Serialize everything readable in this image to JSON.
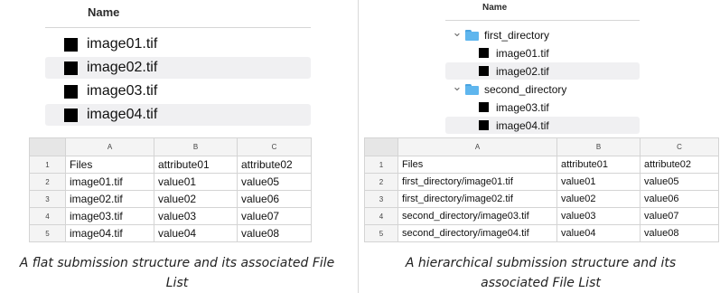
{
  "left": {
    "header": "Name",
    "files": [
      {
        "name": "image01.tif",
        "shaded": false
      },
      {
        "name": "image02.tif",
        "shaded": true
      },
      {
        "name": "image03.tif",
        "shaded": false
      },
      {
        "name": "image04.tif",
        "shaded": true
      }
    ],
    "sheet": {
      "columns": [
        "A",
        "B",
        "C"
      ],
      "rows": [
        {
          "num": "1",
          "cells": [
            "Files",
            "attribute01",
            "attribute02"
          ]
        },
        {
          "num": "2",
          "cells": [
            "image01.tif",
            "value01",
            "value05"
          ]
        },
        {
          "num": "3",
          "cells": [
            "image02.tif",
            "value02",
            "value06"
          ]
        },
        {
          "num": "4",
          "cells": [
            "image03.tif",
            "value03",
            "value07"
          ]
        },
        {
          "num": "5",
          "cells": [
            "image04.tif",
            "value04",
            "value08"
          ]
        }
      ]
    },
    "caption_lines": [
      "A flat submission structure and its associated File",
      "List"
    ]
  },
  "right": {
    "header": "Name",
    "folders": [
      {
        "name": "first_directory",
        "files": [
          {
            "name": "image01.tif",
            "shaded": false
          },
          {
            "name": "image02.tif",
            "shaded": true
          }
        ]
      },
      {
        "name": "second_directory",
        "files": [
          {
            "name": "image03.tif",
            "shaded": false
          },
          {
            "name": "image04.tif",
            "shaded": true
          }
        ]
      }
    ],
    "sheet": {
      "columns": [
        "A",
        "B",
        "C"
      ],
      "rows": [
        {
          "num": "1",
          "cells": [
            "Files",
            "attribute01",
            "attribute02"
          ]
        },
        {
          "num": "2",
          "cells": [
            "first_directory/image01.tif",
            "value01",
            "value05"
          ]
        },
        {
          "num": "3",
          "cells": [
            "first_directory/image02.tif",
            "value02",
            "value06"
          ]
        },
        {
          "num": "4",
          "cells": [
            "second_directory/image03.tif",
            "value03",
            "value07"
          ]
        },
        {
          "num": "5",
          "cells": [
            "second_directory/image04.tif",
            "value04",
            "value08"
          ]
        }
      ]
    },
    "caption_lines": [
      "A hierarchical submission structure and its",
      "associated File List"
    ]
  },
  "icons": {
    "file": "file-icon",
    "folder": "folder-icon",
    "chevron": "chevron-down-icon"
  },
  "colors": {
    "folder": "#5fb6ee",
    "row_shade": "#f0f0f2",
    "grid": "#d4d4d4",
    "header_bg": "#f4f4f4"
  }
}
